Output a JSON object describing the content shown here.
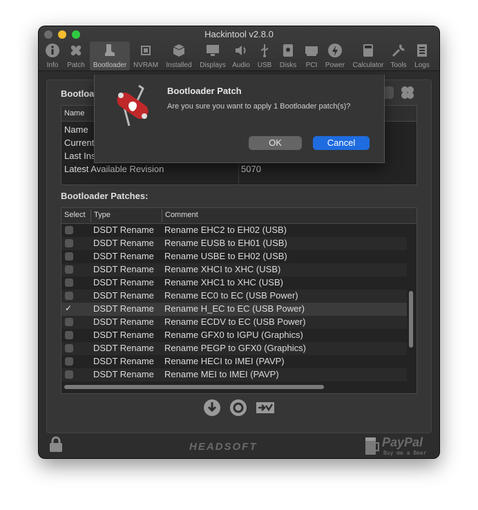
{
  "window": {
    "title": "Hackintool v2.8.0"
  },
  "toolbar": {
    "items": [
      {
        "label": "Info",
        "icon": "info-icon"
      },
      {
        "label": "Patch",
        "icon": "patch-icon"
      },
      {
        "label": "Bootloader",
        "icon": "boot-icon",
        "selected": true
      },
      {
        "label": "NVRAM",
        "icon": "chip-icon"
      },
      {
        "label": "Installed",
        "icon": "box-icon"
      },
      {
        "label": "Displays",
        "icon": "display-icon"
      },
      {
        "label": "Audio",
        "icon": "speaker-icon"
      },
      {
        "label": "USB",
        "icon": "usb-icon"
      },
      {
        "label": "Disks",
        "icon": "disk-icon"
      },
      {
        "label": "PCI",
        "icon": "pci-icon"
      },
      {
        "label": "Power",
        "icon": "power-icon"
      },
      {
        "label": "Calculator",
        "icon": "calculator-icon"
      },
      {
        "label": "Tools",
        "icon": "wrench-icon"
      },
      {
        "label": "Logs",
        "icon": "logs-icon"
      }
    ]
  },
  "bootloader_section": {
    "label_visible": "Bootloa",
    "header_name": "Name",
    "rows": [
      {
        "name": "Name",
        "value": ""
      },
      {
        "name": "Current",
        "value": ""
      },
      {
        "name": "Last Ins",
        "value": ""
      },
      {
        "name": "Latest Available Revision",
        "value": "5070"
      }
    ]
  },
  "patches": {
    "label": "Bootloader Patches:",
    "columns": {
      "select": "Select",
      "type": "Type",
      "comment": "Comment"
    },
    "rows": [
      {
        "checked": false,
        "type": "DSDT Rename",
        "comment": "Rename EHC2 to EH02 (USB)"
      },
      {
        "checked": false,
        "type": "DSDT Rename",
        "comment": "Rename EUSB to EH01 (USB)"
      },
      {
        "checked": false,
        "type": "DSDT Rename",
        "comment": "Rename USBE to EH02 (USB)"
      },
      {
        "checked": false,
        "type": "DSDT Rename",
        "comment": "Rename XHCI to XHC (USB)"
      },
      {
        "checked": false,
        "type": "DSDT Rename",
        "comment": "Rename XHC1 to XHC (USB)"
      },
      {
        "checked": false,
        "type": "DSDT Rename",
        "comment": "Rename EC0 to EC (USB Power)"
      },
      {
        "checked": true,
        "type": "DSDT Rename",
        "comment": "Rename H_EC to EC (USB Power)"
      },
      {
        "checked": false,
        "type": "DSDT Rename",
        "comment": "Rename ECDV to EC (USB Power)"
      },
      {
        "checked": false,
        "type": "DSDT Rename",
        "comment": "Rename GFX0 to IGPU (Graphics)"
      },
      {
        "checked": false,
        "type": "DSDT Rename",
        "comment": "Rename PEGP to GFX0 (Graphics)"
      },
      {
        "checked": false,
        "type": "DSDT Rename",
        "comment": "Rename HECI to IMEI (PAVP)"
      },
      {
        "checked": false,
        "type": "DSDT Rename",
        "comment": "Rename MEI to IMEI (PAVP)"
      }
    ]
  },
  "dialog": {
    "title": "Bootloader Patch",
    "message": "Are you sure you want to apply 1 Bootloader patch(s)?",
    "ok_label": "OK",
    "cancel_label": "Cancel"
  },
  "footer": {
    "brand": "HEADSOFT",
    "paypal": "PayPal",
    "beer": "Buy me a Beer"
  },
  "colors": {
    "accent": "#1f6ce0",
    "window_bg": "#2d2d2d",
    "table_bg": "#232323"
  }
}
